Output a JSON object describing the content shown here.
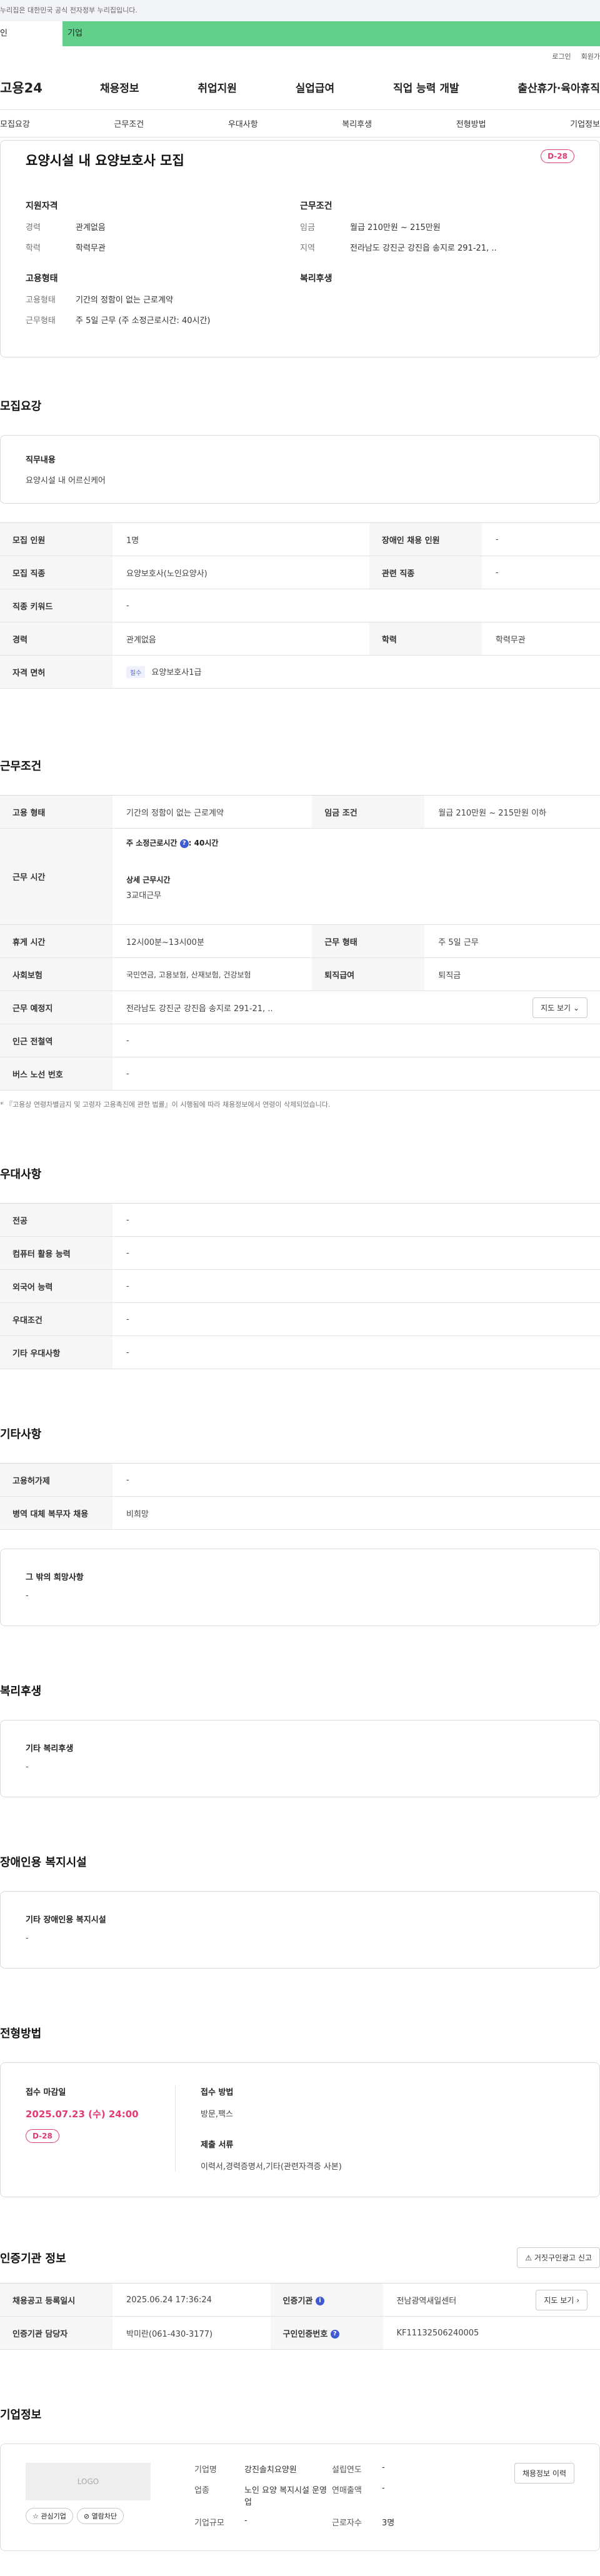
{
  "gov_banner": "누리집은 대한민국 공식 전자정부 누리집입니다.",
  "tabs": {
    "left": "인",
    "right": "기업"
  },
  "util": {
    "login": "로그인",
    "join": "회원가"
  },
  "logo": "고용24",
  "gnb": [
    "채용정보",
    "취업지원",
    "실업급여",
    "직업 능력 개발",
    "출산휴가·육아휴직"
  ],
  "subnav": [
    "모집요강",
    "근무조건",
    "우대사항",
    "복리후생",
    "전형방법",
    "기업정보"
  ],
  "summary": {
    "title": "요양시설 내 요양보호사 모집",
    "dday": "D-28",
    "qual_head": "지원자격",
    "career_k": "경력",
    "career_v": "관계없음",
    "edu_k": "학력",
    "edu_v": "학력무관",
    "emp_head": "고용형태",
    "emptype_k": "고용형태",
    "emptype_v": "기간의 정함이 없는 근로계약",
    "worktype_k": "근무형태",
    "worktype_v": "주 5일 근무 (주 소정근로시간: 40시간)",
    "cond_head": "근무조건",
    "wage_k": "임금",
    "wage_v": "월급 210만원 ~ 215만원",
    "region_k": "지역",
    "region_v": "전라남도 강진군 강진읍 송지로 291-21, ..",
    "welfare_head": "복리후생"
  },
  "recruit": {
    "title": "모집요강",
    "duty_label": "직무내용",
    "duty_text": "요양시설 내 어르신케어",
    "rows": {
      "count_k": "모집 인원",
      "count_v": "1명",
      "disab_k": "장애인 채용 인원",
      "disab_v": "-",
      "job_k": "모집 직종",
      "job_v": "요양보호사(노인요양사)",
      "related_k": "관련 직종",
      "related_v": "-",
      "keyword_k": "직종 키워드",
      "keyword_v": "-",
      "career_k": "경력",
      "career_v": "관계없음",
      "edu_k": "학력",
      "edu_v": "학력무관",
      "license_k": "자격 면허",
      "license_badge": "필수",
      "license_v": "요양보호사1급"
    }
  },
  "conditions": {
    "title": "근무조건",
    "emp_k": "고용 형태",
    "emp_v": "기간의 정함이 없는 근로계약",
    "wage_k": "임금 조건",
    "wage_v": "월급 210만원 ~ 215만원 이하",
    "hours_k": "근무 시간",
    "hours_weekly": "주 소정근로시간 ",
    "hours_weekly_val": ": 40시간",
    "hours_detail_label": "상세 근무시간",
    "hours_detail": "3교대근무",
    "break_k": "휴게 시간",
    "break_v": "12시00분~13시00분",
    "form_k": "근무 형태",
    "form_v": "주 5일 근무",
    "insure_k": "사회보험",
    "insure_v": "국민연금, 고용보험, 산재보험, 건강보험",
    "retire_k": "퇴직급여",
    "retire_v": "퇴직금",
    "place_k": "근무 예정지",
    "place_v": "전라남도 강진군 강진읍 송지로 291-21, ..",
    "map_btn": "지도 보기",
    "subway_k": "인근 전철역",
    "subway_v": "-",
    "bus_k": "버스 노선 번호",
    "bus_v": "-",
    "note": "* 『고용상 연령차별금지 및 고령자 고용촉진에 관한 법률』이 시행됨에 따라 채용정보에서 연령이 삭제되었습니다."
  },
  "preference": {
    "title": "우대사항",
    "major_k": "전공",
    "major_v": "-",
    "pc_k": "컴퓨터 활용 능력",
    "pc_v": "-",
    "lang_k": "외국어 능력",
    "lang_v": "-",
    "pref_k": "우대조건",
    "pref_v": "-",
    "etc_k": "기타 우대사항",
    "etc_v": "-"
  },
  "others": {
    "title": "기타사항",
    "employ_k": "고용허가제",
    "employ_v": "-",
    "military_k": "병역 대체 복무자 채용",
    "military_v": "비희망",
    "hope_label": "그 밖의 희망사항",
    "hope_v": "-"
  },
  "welfare": {
    "title": "복리후생",
    "label": "기타 복리후생",
    "value": "-"
  },
  "disability": {
    "title": "장애인용 복지시설",
    "label": "기타 장애인용 복지시설",
    "value": "-"
  },
  "process": {
    "title": "전형방법",
    "deadline_label": "접수 마감일",
    "deadline": "2025.07.23 (수) 24:00",
    "dday": "D-28",
    "method_label": "접수 방법",
    "method": "방문,팩스",
    "docs_label": "제출 서류",
    "docs": "이력서,경력증명서,기타(관련자격증 사본)"
  },
  "agency": {
    "title": "인증기관 정보",
    "report_btn": "거짓구인광고 신고",
    "regdate_k": "채용공고 등록일시",
    "regdate_v": "2025.06.24 17:36:24",
    "org_k": "인증기관",
    "org_v": "전남광역새일센터",
    "map_btn": "지도 보기",
    "manager_k": "인증기관 담당자",
    "manager_v": "박미란(061-430-3177)",
    "reqno_k": "구인인증번호",
    "reqno_v": "KF11132506240005"
  },
  "company": {
    "title": "기업정보",
    "logo_text": "LOGO",
    "interest_btn": "관심기업",
    "block_btn": "열람차단",
    "name_k": "기업명",
    "name_v": "강진솔치요양원",
    "industry_k": "업종",
    "industry_v": "노인 요양 복지시설 운영업",
    "scale_k": "기업규모",
    "scale_v": "-",
    "founded_k": "설립연도",
    "founded_v": "-",
    "sales_k": "연매출액",
    "sales_v": "-",
    "staff_k": "근로자수",
    "staff_v": "3명",
    "history_btn": "채용정보 이력"
  },
  "icons": {
    "chevron": "chevron-down-icon",
    "star": "star-icon",
    "info": "info-icon",
    "siren": "report-icon"
  }
}
